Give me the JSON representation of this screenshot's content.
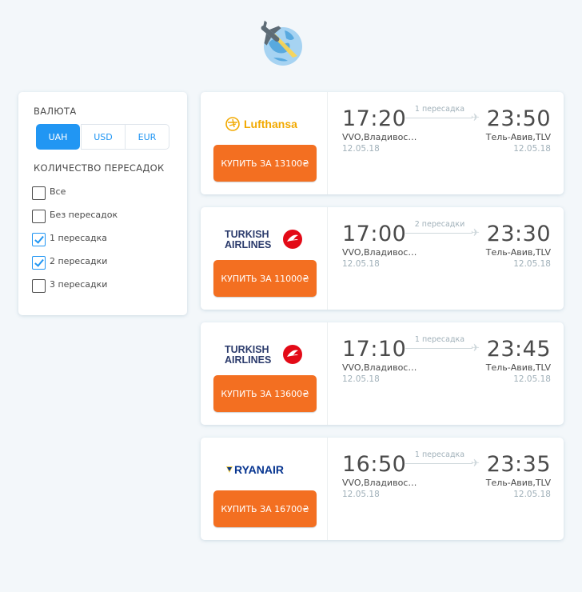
{
  "filter": {
    "currency_title": "ВАЛЮТА",
    "currencies": [
      {
        "label": "UAH",
        "active": true
      },
      {
        "label": "USD",
        "active": false
      },
      {
        "label": "EUR",
        "active": false
      }
    ],
    "stops_title": "КОЛИЧЕСТВО ПЕРЕСАДОК",
    "stops": [
      {
        "label": "Все",
        "checked": false
      },
      {
        "label": "Без пересадок",
        "checked": false
      },
      {
        "label": "1 пересадка",
        "checked": true
      },
      {
        "label": "2 пересадки",
        "checked": true
      },
      {
        "label": "3 пересадки",
        "checked": false
      }
    ]
  },
  "tickets": [
    {
      "carrier": "Lufthansa",
      "buy_label": "КУПИТЬ ЗА 13100₴",
      "departure_time": "17:20",
      "arrival_time": "23:50",
      "stops_label": "1 пересадка",
      "origin": "VVO,Владивос…",
      "destination": "Тель-Авив,TLV",
      "departure_date": "12.05.18",
      "arrival_date": "12.05.18"
    },
    {
      "carrier": "Turkish Airlines",
      "buy_label": "КУПИТЬ ЗА 11000₴",
      "departure_time": "17:00",
      "arrival_time": "23:30",
      "stops_label": "2 пересадки",
      "origin": "VVO,Владивос…",
      "destination": "Тель-Авив,TLV",
      "departure_date": "12.05.18",
      "arrival_date": "12.05.18"
    },
    {
      "carrier": "Turkish Airlines",
      "buy_label": "КУПИТЬ ЗА 13600₴",
      "departure_time": "17:10",
      "arrival_time": "23:45",
      "stops_label": "1 пересадка",
      "origin": "VVO,Владивос…",
      "destination": "Тель-Авив,TLV",
      "departure_date": "12.05.18",
      "arrival_date": "12.05.18"
    },
    {
      "carrier": "Ryanair",
      "buy_label": "КУПИТЬ ЗА 16700₴",
      "departure_time": "16:50",
      "arrival_time": "23:35",
      "stops_label": "1 пересадка",
      "origin": "VVO,Владивос…",
      "destination": "Тель-Авив,TLV",
      "departure_date": "12.05.18",
      "arrival_date": "12.05.18"
    }
  ],
  "colors": {
    "accent": "#2196f3",
    "buy_button": "#f36f21",
    "background": "#f3f7fa"
  }
}
